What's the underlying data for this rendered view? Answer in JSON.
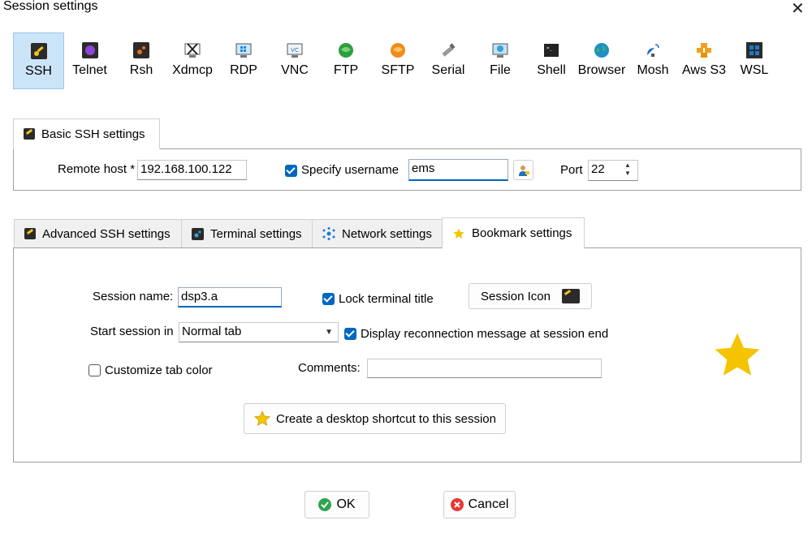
{
  "window": {
    "title": "Session settings",
    "close_glyph": "✕"
  },
  "session_types": [
    {
      "label": "SSH",
      "icon": "ssh-key-icon",
      "color": "#f2c418"
    },
    {
      "label": "Telnet",
      "icon": "telnet-icon",
      "color": "#7a3fbf"
    },
    {
      "label": "Rsh",
      "icon": "rsh-icon",
      "color": "#e07020"
    },
    {
      "label": "Xdmcp",
      "icon": "xdmcp-icon",
      "color": "#555555"
    },
    {
      "label": "RDP",
      "icon": "rdp-icon",
      "color": "#1e88e5"
    },
    {
      "label": "VNC",
      "icon": "vnc-icon",
      "color": "#607d8b"
    },
    {
      "label": "FTP",
      "icon": "ftp-icon",
      "color": "#2e9e3e"
    },
    {
      "label": "SFTP",
      "icon": "sftp-icon",
      "color": "#f08c1a"
    },
    {
      "label": "Serial",
      "icon": "serial-icon",
      "color": "#888888"
    },
    {
      "label": "File",
      "icon": "file-icon",
      "color": "#3aa0d8"
    },
    {
      "label": "Shell",
      "icon": "shell-icon",
      "color": "#222222"
    },
    {
      "label": "Browser",
      "icon": "globe-icon",
      "color": "#1e90c8"
    },
    {
      "label": "Mosh",
      "icon": "mosh-satellite-icon",
      "color": "#1e70c0"
    },
    {
      "label": "Aws S3",
      "icon": "aws-s3-icon",
      "color": "#f0a020"
    },
    {
      "label": "WSL",
      "icon": "windows-icon",
      "color": "#1e78d0"
    }
  ],
  "basic": {
    "tab_label": "Basic SSH settings",
    "remote_host_label": "Remote host *",
    "remote_host_value": "192.168.100.122",
    "specify_username_label": "Specify username",
    "username_value": "ems",
    "port_label": "Port",
    "port_value": "22"
  },
  "tabs": [
    {
      "label": "Advanced SSH settings",
      "icon": "ssh-key-icon"
    },
    {
      "label": "Terminal settings",
      "icon": "terminal-icon"
    },
    {
      "label": "Network settings",
      "icon": "network-icon"
    },
    {
      "label": "Bookmark settings",
      "icon": "star-icon"
    }
  ],
  "bookmark": {
    "session_name_label": "Session name:",
    "session_name_value": "dsp3.a",
    "lock_title_label": "Lock terminal title",
    "session_icon_label": "Session Icon",
    "start_in_label": "Start session in",
    "start_in_value": "Normal tab",
    "reconnect_msg_label": "Display reconnection message at session end",
    "customize_tab_label": "Customize tab color",
    "comments_label": "Comments:",
    "comments_value": "",
    "shortcut_label": "Create a desktop shortcut to this session",
    "star_color": "#f5c400"
  },
  "footer": {
    "ok_label": "OK",
    "cancel_label": "Cancel",
    "ok_color": "#2ea44f",
    "cancel_color": "#e53935"
  }
}
